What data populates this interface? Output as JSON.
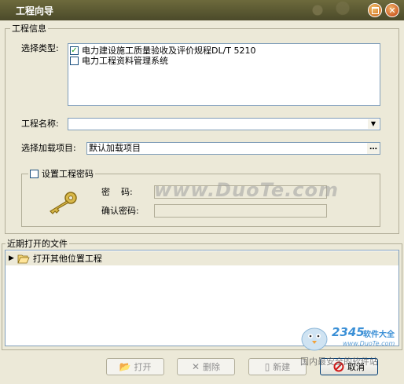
{
  "window": {
    "title": "工程向导"
  },
  "project_info": {
    "group_label": "工程信息",
    "type_label": "选择类型:",
    "types": [
      {
        "label": "电力建设施工质量验收及评价规程DL/T 5210",
        "checked": true
      },
      {
        "label": "电力工程资料管理系统",
        "checked": false
      }
    ],
    "name_label": "工程名称:",
    "name_value": "",
    "load_label": "选择加载项目:",
    "load_value": "默认加载项目",
    "browse_label": "…",
    "password": {
      "toggle_label": "设置工程密码",
      "enabled": false,
      "password_label": "密    码:",
      "confirm_label": "确认密码:"
    }
  },
  "recent": {
    "group_label": "近期打开的文件",
    "items": [
      {
        "label": "打开其他位置工程"
      }
    ]
  },
  "buttons": {
    "open": "打开",
    "delete": "删除",
    "new": "新建",
    "cancel": "取消"
  },
  "watermark": {
    "text": "www.DuoTe.com",
    "logo_number": "2345",
    "logo_text": "软件大全",
    "logo_url": "www.DuoTe.com",
    "logo_tagline": "国内最安全的软件站"
  },
  "colors": {
    "title_bar": "#5a5834",
    "dialog_bg": "#ece9d8",
    "field_border": "#7f9db9",
    "cancel_icon": "#d11a1a"
  }
}
